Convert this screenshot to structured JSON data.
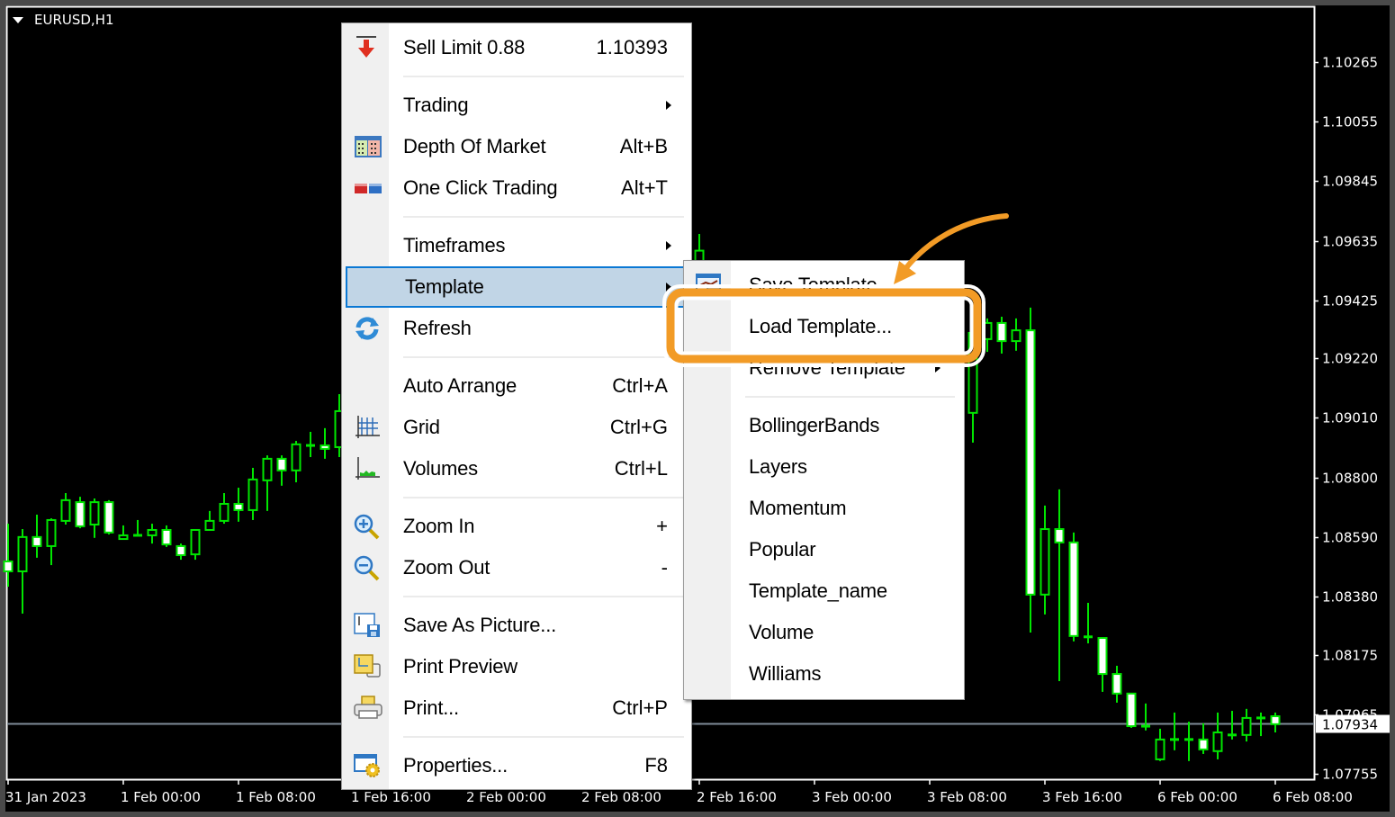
{
  "chart_window": {
    "symbol_title": "EURUSD,H1",
    "current_price": 1.07934,
    "current_price_label": "1.07934",
    "colors": {
      "background": "#000000",
      "frame": "#ffffff",
      "candle_outline": "#00e600",
      "bull_fill": "#000000",
      "bear_fill": "#ffffff",
      "current_price_line": "#7f8c99",
      "annotation_orange": "#f29b26"
    }
  },
  "chart_data": {
    "type": "candlestick",
    "title": "EURUSD,H1",
    "ylim": [
      1.07755,
      1.10265
    ],
    "price_axis_labels": [
      "1.10265",
      "1.10055",
      "1.09845",
      "1.09635",
      "1.09425",
      "1.09220",
      "1.09010",
      "1.08800",
      "1.08590",
      "1.08380",
      "1.08175",
      "1.07965",
      "1.07755"
    ],
    "time_axis_labels": [
      {
        "bar": 0,
        "label": "31 Jan 2023"
      },
      {
        "bar": 8,
        "label": "1 Feb 00:00"
      },
      {
        "bar": 16,
        "label": "1 Feb 08:00"
      },
      {
        "bar": 24,
        "label": "1 Feb 16:00"
      },
      {
        "bar": 32,
        "label": "2 Feb 00:00"
      },
      {
        "bar": 40,
        "label": "2 Feb 08:00"
      },
      {
        "bar": 48,
        "label": "2 Feb 16:00"
      },
      {
        "bar": 56,
        "label": "3 Feb 00:00"
      },
      {
        "bar": 64,
        "label": "3 Feb 08:00"
      },
      {
        "bar": 72,
        "label": "3 Feb 16:00"
      },
      {
        "bar": 80,
        "label": "6 Feb 00:00"
      },
      {
        "bar": 88,
        "label": "6 Feb 08:00"
      }
    ],
    "candles": [
      {
        "bar": 0,
        "o": 1.08504,
        "h": 1.08637,
        "l": 1.08415,
        "c": 1.08469
      },
      {
        "bar": 1,
        "o": 1.08469,
        "h": 1.08618,
        "l": 1.0832,
        "c": 1.0859
      },
      {
        "bar": 2,
        "o": 1.0859,
        "h": 1.08669,
        "l": 1.08517,
        "c": 1.08558
      },
      {
        "bar": 3,
        "o": 1.08558,
        "h": 1.08656,
        "l": 1.08491,
        "c": 1.0865
      },
      {
        "bar": 4,
        "o": 1.08647,
        "h": 1.08745,
        "l": 1.08634,
        "c": 1.0872
      },
      {
        "bar": 5,
        "o": 1.08713,
        "h": 1.08732,
        "l": 1.08621,
        "c": 1.08628
      },
      {
        "bar": 6,
        "o": 1.08634,
        "h": 1.08726,
        "l": 1.08587,
        "c": 1.08713
      },
      {
        "bar": 7,
        "o": 1.08713,
        "h": 1.0872,
        "l": 1.08599,
        "c": 1.08606
      },
      {
        "bar": 8,
        "o": 1.08583,
        "h": 1.08631,
        "l": 1.08583,
        "c": 1.08596
      },
      {
        "bar": 9,
        "o": 1.08596,
        "h": 1.0865,
        "l": 1.08596,
        "c": 1.08596
      },
      {
        "bar": 10,
        "o": 1.08596,
        "h": 1.08637,
        "l": 1.08567,
        "c": 1.08615
      },
      {
        "bar": 11,
        "o": 1.08615,
        "h": 1.08631,
        "l": 1.08555,
        "c": 1.08564
      },
      {
        "bar": 12,
        "o": 1.08558,
        "h": 1.08567,
        "l": 1.0851,
        "c": 1.08526
      },
      {
        "bar": 13,
        "o": 1.08529,
        "h": 1.08615,
        "l": 1.0851,
        "c": 1.08615
      },
      {
        "bar": 14,
        "o": 1.08615,
        "h": 1.08682,
        "l": 1.08615,
        "c": 1.08647
      },
      {
        "bar": 15,
        "o": 1.08647,
        "h": 1.08745,
        "l": 1.08637,
        "c": 1.08707
      },
      {
        "bar": 16,
        "o": 1.08707,
        "h": 1.08764,
        "l": 1.08644,
        "c": 1.08685
      },
      {
        "bar": 17,
        "o": 1.08685,
        "h": 1.08834,
        "l": 1.0865,
        "c": 1.08793
      },
      {
        "bar": 18,
        "o": 1.0879,
        "h": 1.08878,
        "l": 1.08682,
        "c": 1.08866
      },
      {
        "bar": 19,
        "o": 1.08866,
        "h": 1.08878,
        "l": 1.08771,
        "c": 1.08825
      },
      {
        "bar": 20,
        "o": 1.08825,
        "h": 1.08929,
        "l": 1.08783,
        "c": 1.08917
      },
      {
        "bar": 21,
        "o": 1.08913,
        "h": 1.08961,
        "l": 1.08872,
        "c": 1.08913
      },
      {
        "bar": 22,
        "o": 1.08913,
        "h": 1.08974,
        "l": 1.08866,
        "c": 1.08901
      },
      {
        "bar": 23,
        "o": 1.08907,
        "h": 1.09094,
        "l": 1.08872,
        "c": 1.09034
      },
      {
        "bar": 48,
        "o": 1.093,
        "h": 1.09659,
        "l": 1.0925,
        "c": 1.096
      },
      {
        "bar": 67,
        "o": 1.09028,
        "h": 1.09326,
        "l": 1.08923,
        "c": 1.0931
      },
      {
        "bar": 68,
        "o": 1.09288,
        "h": 1.09361,
        "l": 1.09243,
        "c": 1.09345
      },
      {
        "bar": 69,
        "o": 1.09345,
        "h": 1.09367,
        "l": 1.09237,
        "c": 1.09281
      },
      {
        "bar": 70,
        "o": 1.09281,
        "h": 1.09361,
        "l": 1.09247,
        "c": 1.09319
      },
      {
        "bar": 71,
        "o": 1.09319,
        "h": 1.09399,
        "l": 1.08253,
        "c": 1.08387
      },
      {
        "bar": 72,
        "o": 1.08387,
        "h": 1.08701,
        "l": 1.08317,
        "c": 1.08618
      },
      {
        "bar": 73,
        "o": 1.08618,
        "h": 1.08758,
        "l": 1.08082,
        "c": 1.08571
      },
      {
        "bar": 74,
        "o": 1.08571,
        "h": 1.08606,
        "l": 1.08222,
        "c": 1.08241
      },
      {
        "bar": 75,
        "o": 1.08238,
        "h": 1.08358,
        "l": 1.08215,
        "c": 1.08238
      },
      {
        "bar": 76,
        "o": 1.08234,
        "h": 1.08234,
        "l": 1.08044,
        "c": 1.08107
      },
      {
        "bar": 77,
        "o": 1.08107,
        "h": 1.08136,
        "l": 1.08006,
        "c": 1.08038
      },
      {
        "bar": 78,
        "o": 1.08038,
        "h": 1.08038,
        "l": 1.07917,
        "c": 1.07923
      },
      {
        "bar": 79,
        "o": 1.07923,
        "h": 1.08003,
        "l": 1.07908,
        "c": 1.07923
      },
      {
        "bar": 80,
        "o": 1.07806,
        "h": 1.07914,
        "l": 1.078,
        "c": 1.07876
      },
      {
        "bar": 81,
        "o": 1.07876,
        "h": 1.07971,
        "l": 1.07838,
        "c": 1.07876
      },
      {
        "bar": 82,
        "o": 1.07876,
        "h": 1.07939,
        "l": 1.078,
        "c": 1.07876
      },
      {
        "bar": 83,
        "o": 1.07876,
        "h": 1.07933,
        "l": 1.07825,
        "c": 1.07841
      },
      {
        "bar": 84,
        "o": 1.07835,
        "h": 1.07971,
        "l": 1.07806,
        "c": 1.07901
      },
      {
        "bar": 85,
        "o": 1.07892,
        "h": 1.07977,
        "l": 1.07876,
        "c": 1.07892
      },
      {
        "bar": 86,
        "o": 1.07892,
        "h": 1.07984,
        "l": 1.07869,
        "c": 1.07952
      },
      {
        "bar": 87,
        "o": 1.07952,
        "h": 1.07971,
        "l": 1.07888,
        "c": 1.07952
      },
      {
        "bar": 88,
        "o": 1.07958,
        "h": 1.07971,
        "l": 1.07901,
        "c": 1.0793
      }
    ]
  },
  "context_menu": {
    "items": [
      {
        "type": "item",
        "label": "Sell Limit 0.88",
        "shortcut": "1.10393",
        "icon": "sell-limit-icon"
      },
      {
        "type": "separator"
      },
      {
        "type": "item",
        "label": "Trading",
        "submenu": true
      },
      {
        "type": "item",
        "label": "Depth Of Market",
        "shortcut": "Alt+B",
        "icon": "depth-of-market-icon"
      },
      {
        "type": "item",
        "label": "One Click Trading",
        "shortcut": "Alt+T",
        "icon": "one-click-trading-icon"
      },
      {
        "type": "separator"
      },
      {
        "type": "item",
        "label": "Timeframes",
        "submenu": true
      },
      {
        "type": "item",
        "label": "Template",
        "submenu": true,
        "highlighted": true
      },
      {
        "type": "item",
        "label": "Refresh",
        "icon": "refresh-icon"
      },
      {
        "type": "separator"
      },
      {
        "type": "item",
        "label": "Auto Arrange",
        "shortcut": "Ctrl+A"
      },
      {
        "type": "item",
        "label": "Grid",
        "shortcut": "Ctrl+G",
        "icon": "grid-icon"
      },
      {
        "type": "item",
        "label": "Volumes",
        "shortcut": "Ctrl+L",
        "icon": "volumes-icon"
      },
      {
        "type": "separator"
      },
      {
        "type": "item",
        "label": "Zoom In",
        "shortcut": "+",
        "icon": "zoom-in-icon"
      },
      {
        "type": "item",
        "label": "Zoom Out",
        "shortcut": "-",
        "icon": "zoom-out-icon"
      },
      {
        "type": "separator"
      },
      {
        "type": "item",
        "label": "Save As Picture...",
        "icon": "save-as-picture-icon"
      },
      {
        "type": "item",
        "label": "Print Preview",
        "icon": "print-preview-icon"
      },
      {
        "type": "item",
        "label": "Print...",
        "shortcut": "Ctrl+P",
        "icon": "print-icon"
      },
      {
        "type": "separator"
      },
      {
        "type": "item",
        "label": "Properties...",
        "shortcut": "F8",
        "icon": "properties-icon"
      }
    ]
  },
  "template_submenu": {
    "items": [
      {
        "type": "item",
        "label": "Save Template",
        "icon": "save-template-icon"
      },
      {
        "type": "item",
        "label": "Load Template...",
        "annotated": true
      },
      {
        "type": "item",
        "label": "Remove Template",
        "submenu": true
      },
      {
        "type": "separator"
      },
      {
        "type": "item",
        "label": "BollingerBands"
      },
      {
        "type": "item",
        "label": "Layers"
      },
      {
        "type": "item",
        "label": "Momentum"
      },
      {
        "type": "item",
        "label": "Popular"
      },
      {
        "type": "item",
        "label": "Template_name"
      },
      {
        "type": "item",
        "label": "Volume"
      },
      {
        "type": "item",
        "label": "Williams"
      }
    ]
  }
}
